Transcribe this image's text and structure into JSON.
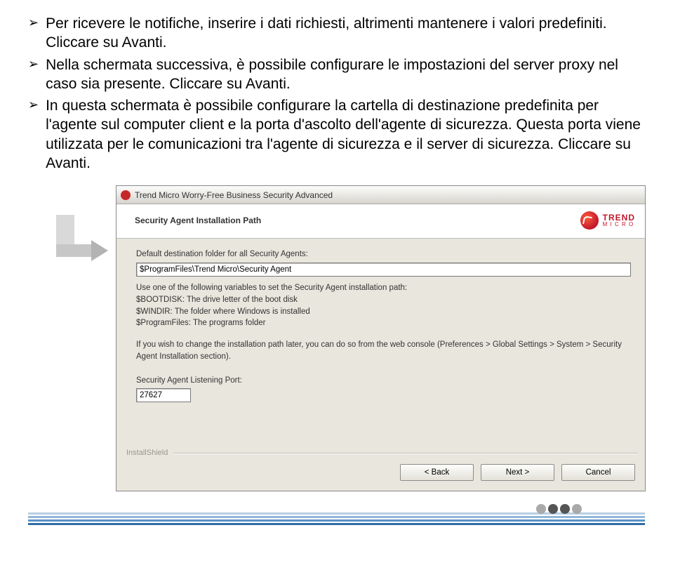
{
  "bullets": [
    "Per ricevere le notifiche, inserire i dati richiesti, altrimenti mantenere i valori predefiniti. Cliccare su Avanti.",
    "Nella schermata successiva, è possibile configurare le impostazioni del server proxy nel caso sia presente. Cliccare su Avanti.",
    "In questa schermata è possibile configurare la cartella di destinazione predefinita per l'agente sul computer client e la porta d'ascolto dell'agente di sicurezza. Questa porta viene utilizzata per le comunicazioni tra l'agente di sicurezza e il server di sicurezza. Cliccare su Avanti."
  ],
  "installer": {
    "title": "Trend Micro Worry-Free Business Security Advanced",
    "header": "Security Agent Installation Path",
    "logo": {
      "line1": "TREND",
      "line2": "M I C R O"
    },
    "dest_label": "Default destination folder for all Security Agents:",
    "dest_value": "$ProgramFiles\\Trend Micro\\Security Agent",
    "vars_intro": "Use one of the following variables to set the Security Agent installation path:",
    "var1": "$BOOTDISK: The drive letter of the boot disk",
    "var2": "$WINDIR: The folder where Windows is installed",
    "var3": "$ProgramFiles: The programs folder",
    "note": "If you wish to change the installation path later, you can do so from the web console (Preferences > Global Settings > System > Security Agent Installation section).",
    "port_label": "Security Agent Listening Port:",
    "port_value": "27627",
    "installshield": "InstallShield",
    "buttons": {
      "back": "< Back",
      "next": "Next >",
      "cancel": "Cancel"
    }
  }
}
